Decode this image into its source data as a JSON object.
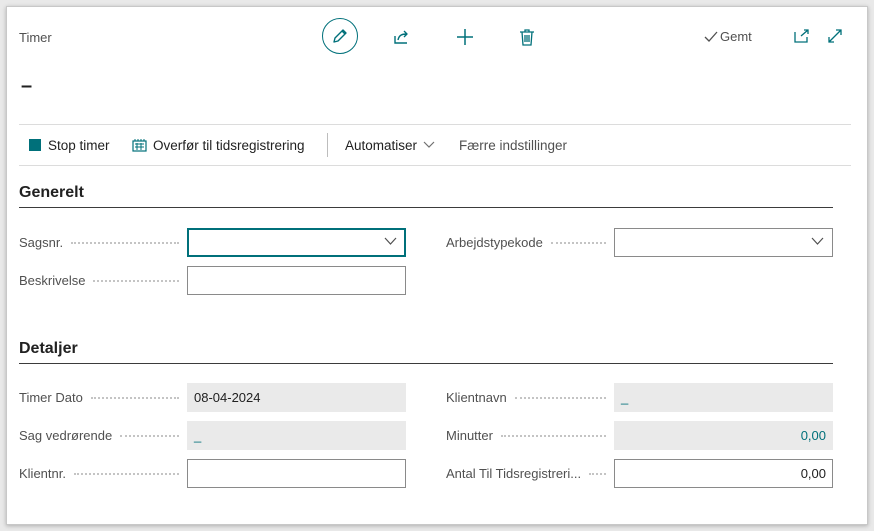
{
  "header": {
    "title": "Timer",
    "saved_label": "Gemt"
  },
  "record": {
    "title": "–"
  },
  "actions": {
    "stop_timer": "Stop timer",
    "transfer": "Overfør til tidsregistrering",
    "automate": "Automatiser",
    "fewer_options": "Færre indstillinger"
  },
  "sections": {
    "general": {
      "title": "Generelt",
      "case_no": {
        "label": "Sagsnr.",
        "value": ""
      },
      "description": {
        "label": "Beskrivelse",
        "value": ""
      },
      "work_type": {
        "label": "Arbejdstypekode",
        "value": ""
      }
    },
    "details": {
      "title": "Detaljer",
      "timer_date": {
        "label": "Timer Dato",
        "value": "08-04-2024"
      },
      "case_regarding": {
        "label": "Sag vedrørende",
        "value": "_"
      },
      "client_no": {
        "label": "Klientnr.",
        "value": ""
      },
      "client_name": {
        "label": "Klientnavn",
        "value": "_"
      },
      "minutes": {
        "label": "Minutter",
        "value": "0,00"
      },
      "qty_to_time_reg": {
        "label": "Antal Til Tidsregistreri...",
        "value": "0,00"
      }
    }
  },
  "colors": {
    "accent": "#00707a",
    "readonly_bg": "#eaeaea"
  }
}
